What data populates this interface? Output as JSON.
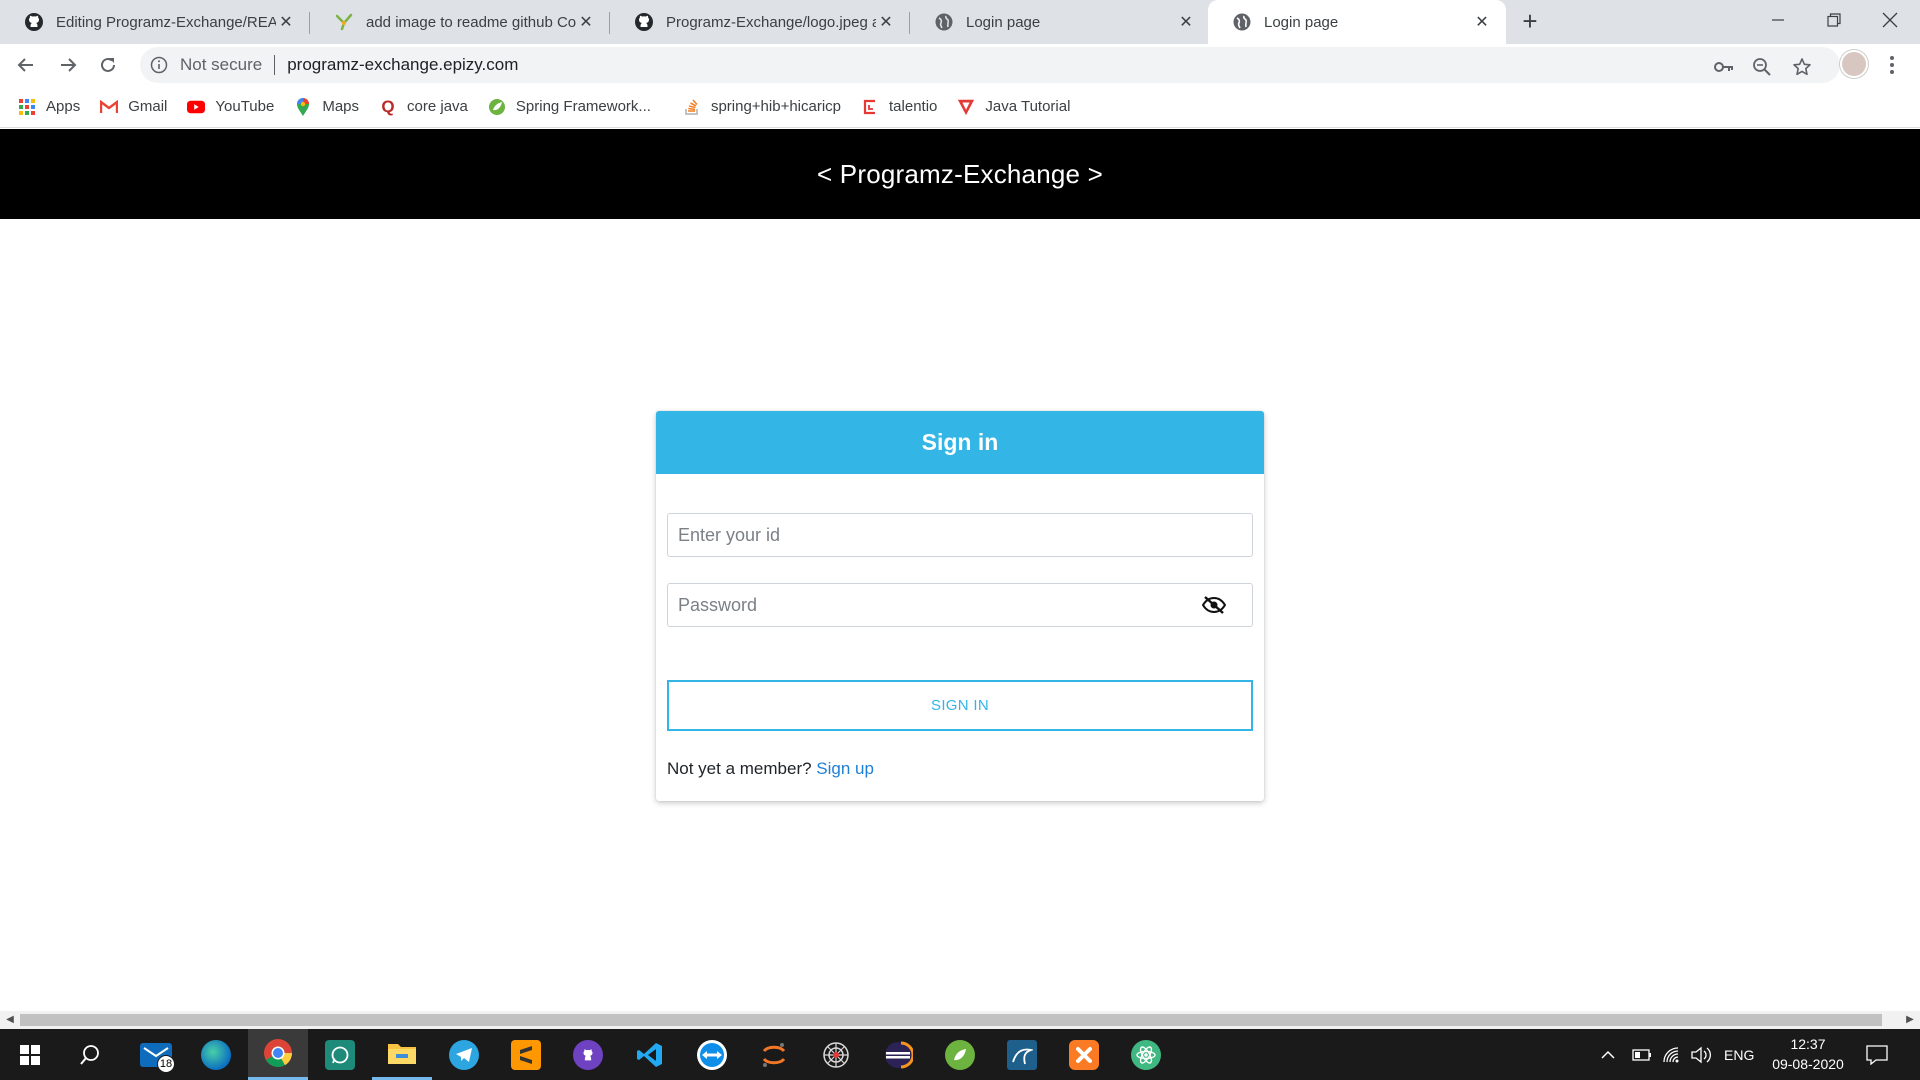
{
  "browser": {
    "tabs": [
      {
        "title": "Editing Programz-Exchange/READ",
        "favicon": "github-icon",
        "active": false
      },
      {
        "title": "add image to readme github Coc",
        "favicon": "grepper-icon",
        "active": false
      },
      {
        "title": "Programz-Exchange/logo.jpeg at",
        "favicon": "github-icon",
        "active": false
      },
      {
        "title": "Login page",
        "favicon": "globe-icon",
        "active": false
      },
      {
        "title": "Login page",
        "favicon": "globe-icon",
        "active": true
      }
    ],
    "address": {
      "security_label": "Not secure",
      "url": "programz-exchange.epizy.com"
    },
    "bookmarks": [
      {
        "label": "Apps",
        "icon": "apps-grid-icon"
      },
      {
        "label": "Gmail",
        "icon": "gmail-icon"
      },
      {
        "label": "YouTube",
        "icon": "youtube-icon"
      },
      {
        "label": "Maps",
        "icon": "maps-icon"
      },
      {
        "label": "core java",
        "icon": "quora-icon"
      },
      {
        "label": "Spring Framework...",
        "icon": "spring-icon"
      },
      {
        "label": "spring+hib+hicaricp",
        "icon": "stackoverflow-icon"
      },
      {
        "label": "talentio",
        "icon": "talentio-icon"
      },
      {
        "label": "Java Tutorial",
        "icon": "javatpoint-icon"
      }
    ]
  },
  "page": {
    "header_title": "< Programz-Exchange >",
    "login": {
      "heading": "Sign in",
      "id_placeholder": "Enter your id",
      "password_placeholder": "Password",
      "submit_label": "SIGN IN",
      "member_prompt": "Not yet a member?",
      "signup_link": "Sign up"
    }
  },
  "taskbar": {
    "mail_badge": "18",
    "language": "ENG",
    "time": "12:37",
    "date": "09-08-2020"
  },
  "colors": {
    "accent": "#33b5e5",
    "header_bg": "#000000",
    "link": "#1f7fd6"
  }
}
